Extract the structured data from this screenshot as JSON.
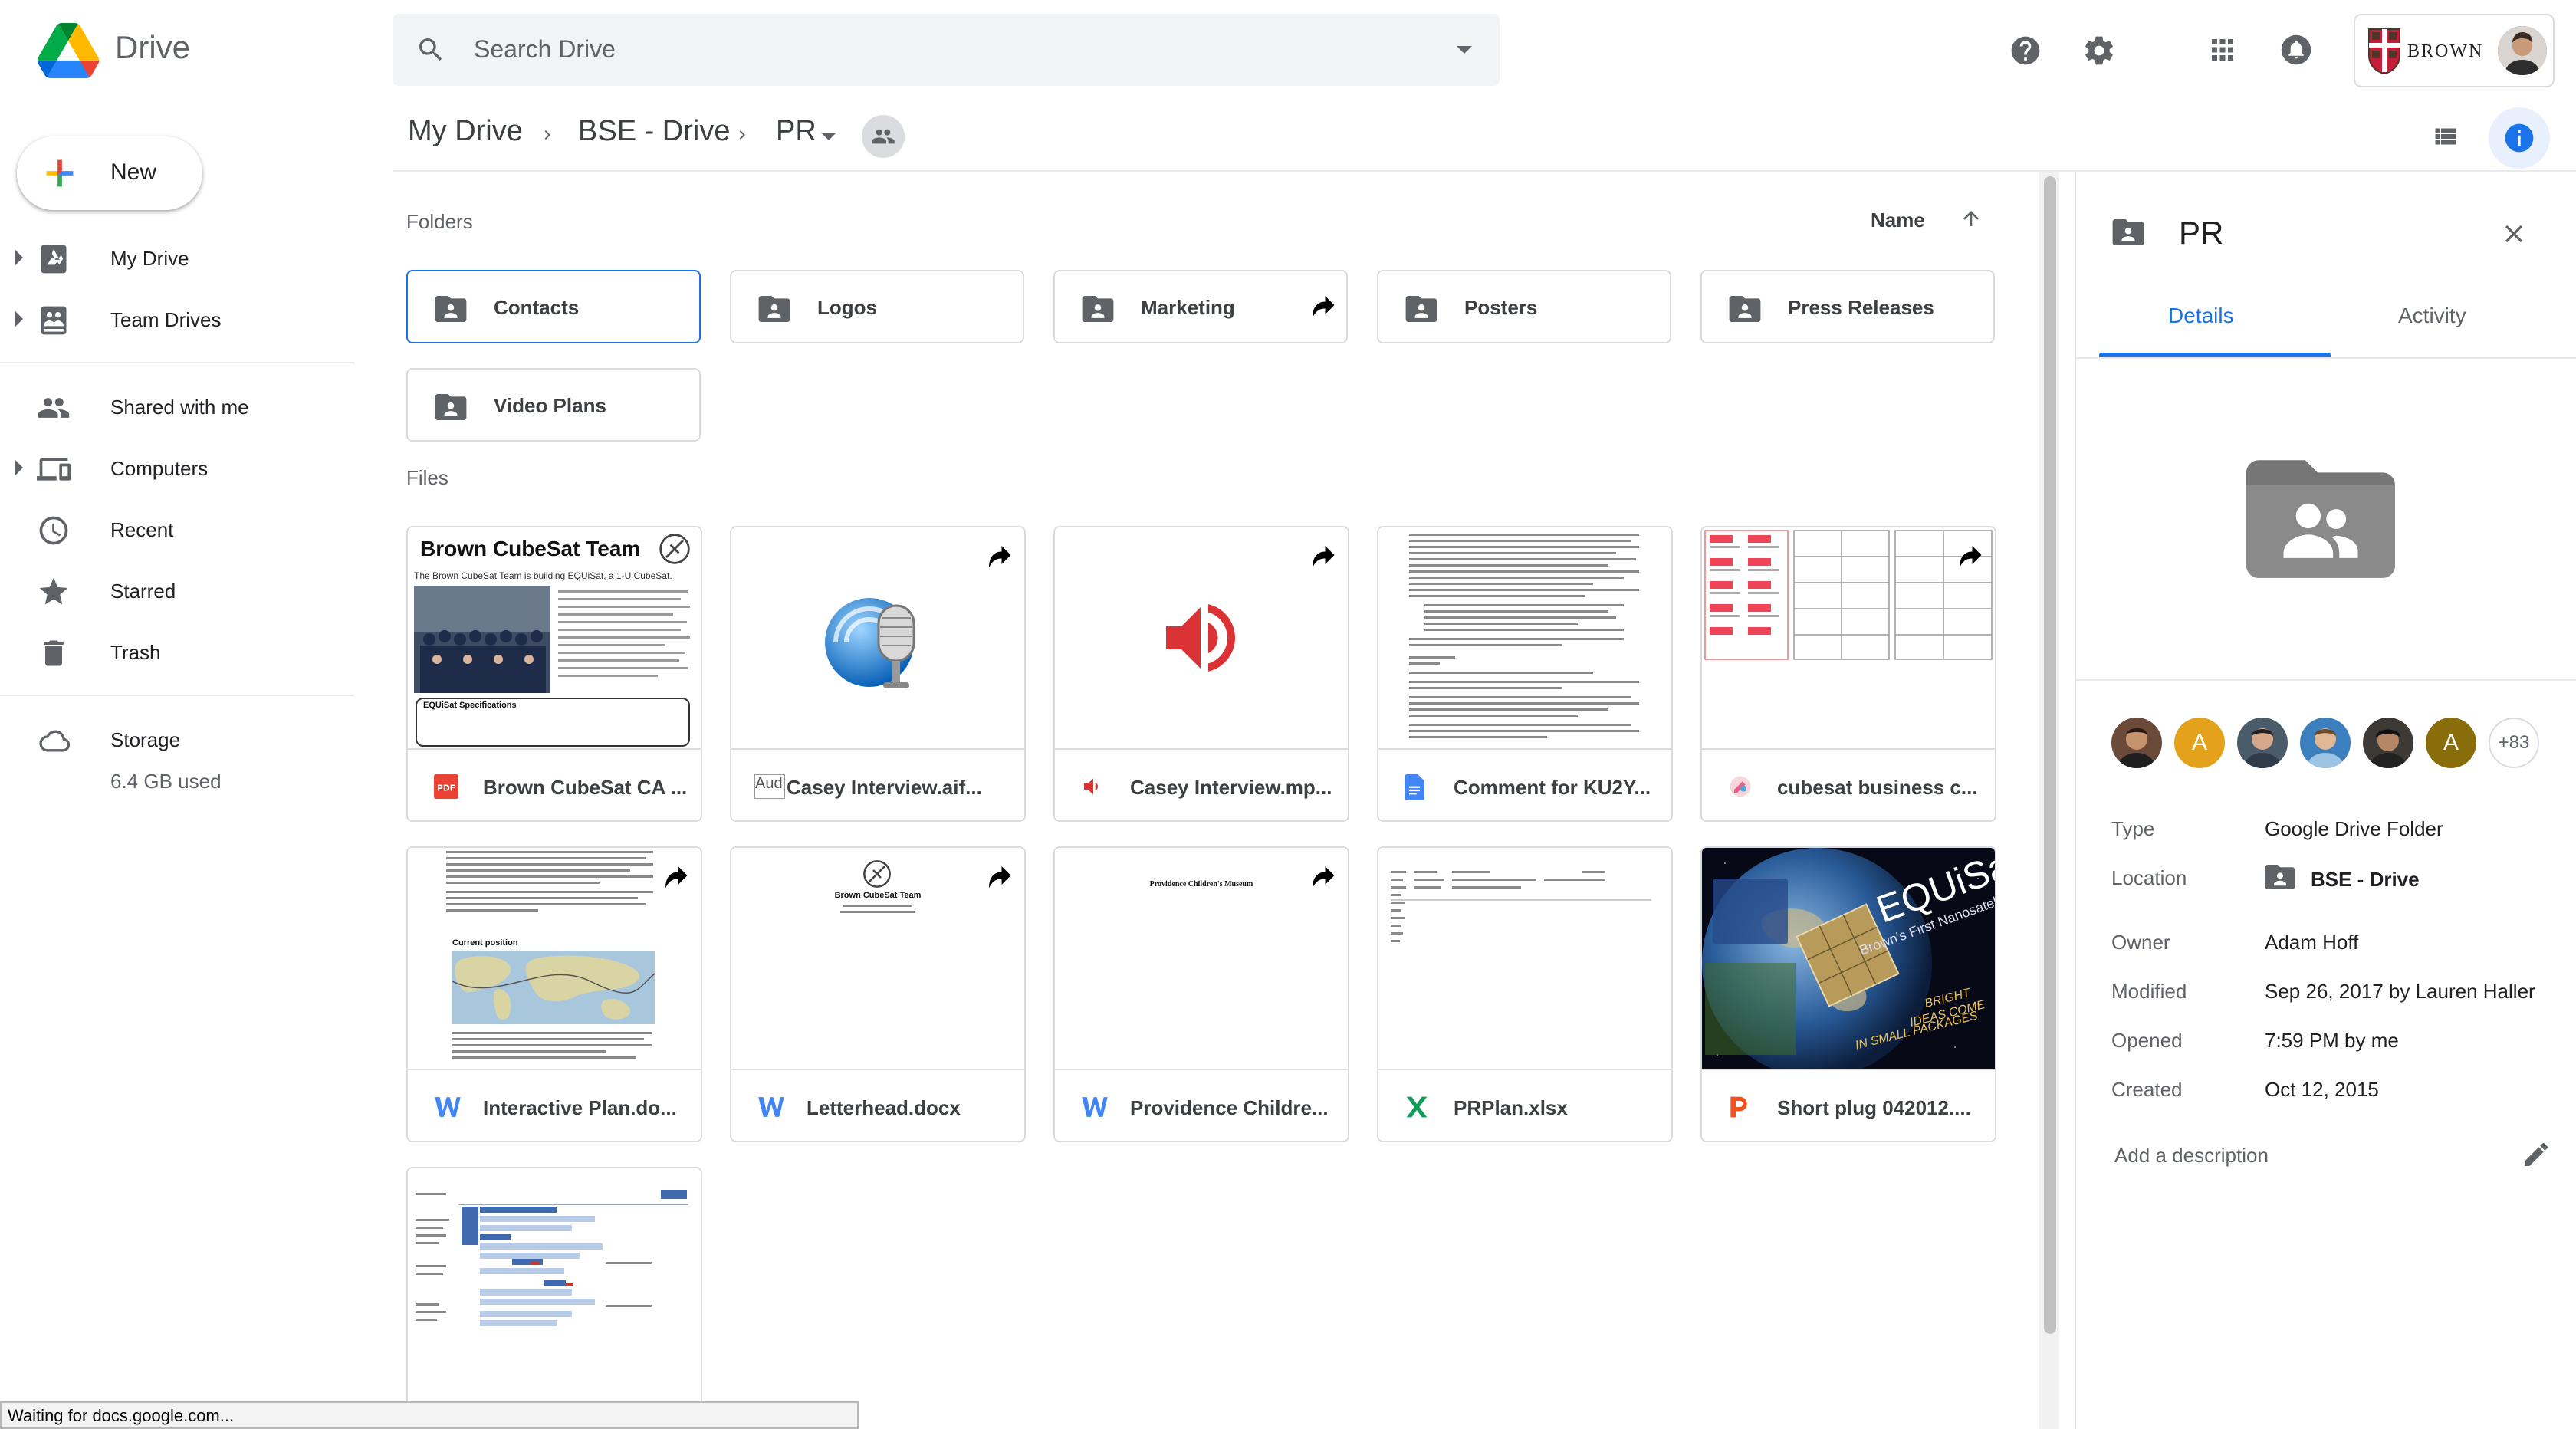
{
  "app": {
    "brand": "Drive"
  },
  "search": {
    "placeholder": "Search Drive"
  },
  "account": {
    "label": "BROWN"
  },
  "sidebar": {
    "new_label": "New",
    "items": [
      {
        "label": "My Drive",
        "icon": "my-drive-icon"
      },
      {
        "label": "Team Drives",
        "icon": "team-drives-icon"
      },
      {
        "label": "Shared with me",
        "icon": "shared-icon"
      },
      {
        "label": "Computers",
        "icon": "computers-icon"
      },
      {
        "label": "Recent",
        "icon": "clock-icon"
      },
      {
        "label": "Starred",
        "icon": "star-icon"
      },
      {
        "label": "Trash",
        "icon": "trash-icon"
      }
    ],
    "storage": {
      "label": "Storage",
      "used": "6.4 GB used"
    }
  },
  "breadcrumb": {
    "items": [
      "My Drive",
      "BSE - Drive",
      "PR"
    ]
  },
  "main": {
    "folders_title": "Folders",
    "files_title": "Files",
    "sort_label": "Name",
    "folders": [
      "Contacts",
      "Logos",
      "Marketing",
      "Posters",
      "Press Releases",
      "Video Plans"
    ],
    "files": [
      {
        "name": "Brown CubeSat CA ...",
        "type": "pdf"
      },
      {
        "name": "Casey Interview.aif...",
        "type": "audio",
        "broken_alt": "Audio"
      },
      {
        "name": "Casey Interview.mp...",
        "type": "audio-mp3"
      },
      {
        "name": "Comment for KU2Y...",
        "type": "doc"
      },
      {
        "name": "cubesat business c...",
        "type": "drawing"
      },
      {
        "name": "Interactive Plan.do...",
        "type": "word"
      },
      {
        "name": "Letterhead.docx",
        "type": "word"
      },
      {
        "name": "Providence Childre...",
        "type": "word"
      },
      {
        "name": "PRPlan.xlsx",
        "type": "excel"
      },
      {
        "name": "Short plug 042012....",
        "type": "powerpoint"
      }
    ],
    "thumb_text": {
      "cubesat_title": "Brown CubeSat Team",
      "cubesat_intro": "The Brown CubeSat Team is building EQUiSat, a 1-U CubeSat.",
      "cubesat_specs": "EQUiSat Specifications",
      "letterhead_title": "Brown CubeSat Team",
      "providence_title": "Providence Children's Museum",
      "equisat_title": "EQUiSat",
      "equisat_sub": "Brown's First Nanosatellite",
      "equisat_slogan1": "BRIGHT",
      "equisat_slogan2": "IDEAS COME",
      "equisat_slogan3": "IN SMALL PACKAGES",
      "interactive_heading": "Current position"
    }
  },
  "details": {
    "title": "PR",
    "tabs": [
      "Details",
      "Activity"
    ],
    "more_count": "+83",
    "avatars": [
      {
        "initial": "",
        "color": "#6b4a3a"
      },
      {
        "initial": "A",
        "color": "#e4a11b"
      },
      {
        "initial": "",
        "color": "#4a5b6a"
      },
      {
        "initial": "",
        "color": "#3b7fbf"
      },
      {
        "initial": "",
        "color": "#3d3a36"
      },
      {
        "initial": "A",
        "color": "#8a6d0b"
      }
    ],
    "meta": [
      {
        "k": "Type",
        "v": "Google Drive Folder"
      },
      {
        "k": "Location",
        "v": "BSE - Drive"
      },
      {
        "k": "Owner",
        "v": "Adam Hoff"
      },
      {
        "k": "Modified",
        "v": "Sep 26, 2017 by Lauren Haller"
      },
      {
        "k": "Opened",
        "v": "7:59 PM by me"
      },
      {
        "k": "Created",
        "v": "Oct 12, 2015"
      }
    ],
    "description_placeholder": "Add a description"
  },
  "status": "Waiting for docs.google.com...",
  "colors": {
    "accent": "#1a73e8",
    "pdf": "#ea4335",
    "word": "#4285f4",
    "excel": "#0f9d58",
    "ppt": "#f4511e"
  }
}
